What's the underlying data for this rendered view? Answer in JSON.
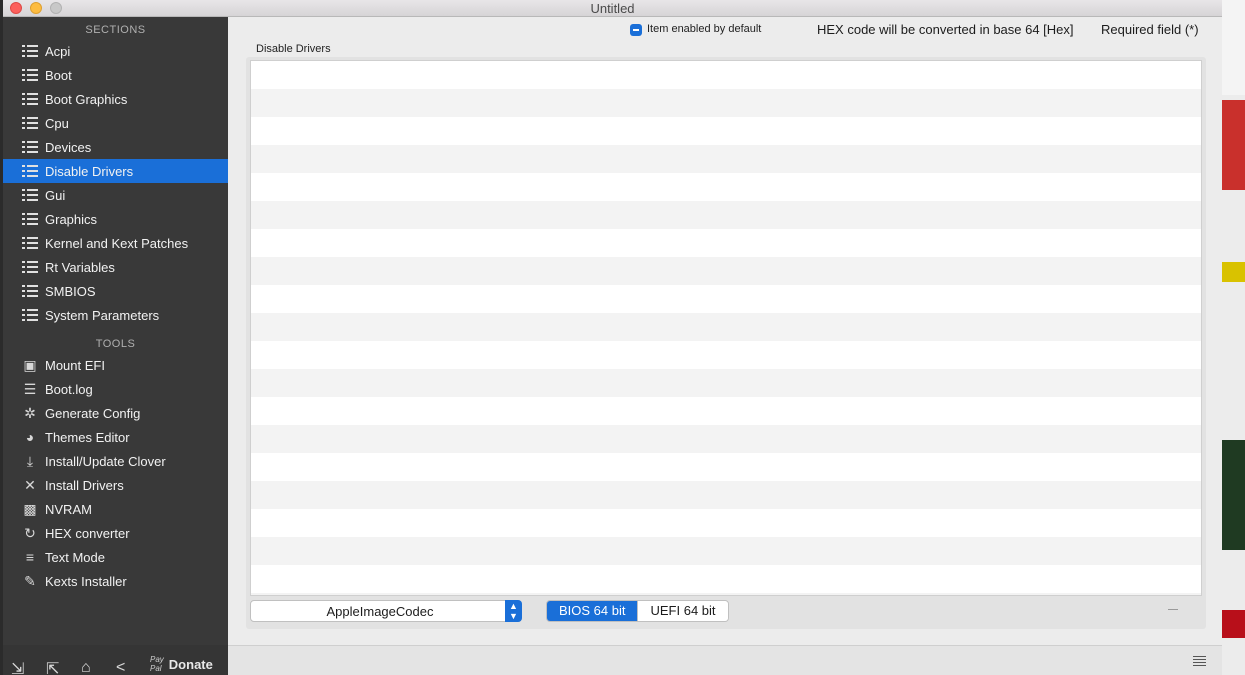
{
  "window": {
    "title": "Untitled"
  },
  "sidebar": {
    "sections_heading": "SECTIONS",
    "sections": [
      {
        "label": "Acpi"
      },
      {
        "label": "Boot"
      },
      {
        "label": "Boot Graphics"
      },
      {
        "label": "Cpu"
      },
      {
        "label": "Devices"
      },
      {
        "label": "Disable Drivers",
        "selected": true
      },
      {
        "label": "Gui"
      },
      {
        "label": "Graphics"
      },
      {
        "label": "Kernel and Kext Patches"
      },
      {
        "label": "Rt Variables"
      },
      {
        "label": "SMBIOS"
      },
      {
        "label": "System Parameters"
      }
    ],
    "tools_heading": "TOOLS",
    "tools": [
      {
        "label": "Mount EFI",
        "icon": "disk-icon"
      },
      {
        "label": "Boot.log",
        "icon": "log-search-icon"
      },
      {
        "label": "Generate Config",
        "icon": "gears-icon"
      },
      {
        "label": "Themes Editor",
        "icon": "palette-icon"
      },
      {
        "label": "Install/Update Clover",
        "icon": "download-icon"
      },
      {
        "label": "Install Drivers",
        "icon": "tools-icon"
      },
      {
        "label": "NVRAM",
        "icon": "chip-icon"
      },
      {
        "label": "HEX converter",
        "icon": "refresh-icon"
      },
      {
        "label": "Text Mode",
        "icon": "text-lines-icon"
      },
      {
        "label": "Kexts Installer",
        "icon": "plug-icon"
      }
    ],
    "bottom": {
      "donate_label": "Donate",
      "paypal_line1": "Pay",
      "paypal_line2": "Pal"
    }
  },
  "main": {
    "item_enabled_label": "Item enabled by default",
    "hex_note": "HEX code will be converted in base 64 [Hex]",
    "required_note": "Required field (*)",
    "panel_title": "Disable Drivers",
    "driver_select_value": "AppleImageCodec",
    "segments": [
      "BIOS 64 bit",
      "UEFI 64 bit"
    ],
    "selected_segment": "BIOS 64 bit",
    "table_rows": []
  },
  "colors": {
    "accent": "#1a6fd8",
    "sidebar_bg": "#393939",
    "content_bg": "#ececec"
  }
}
